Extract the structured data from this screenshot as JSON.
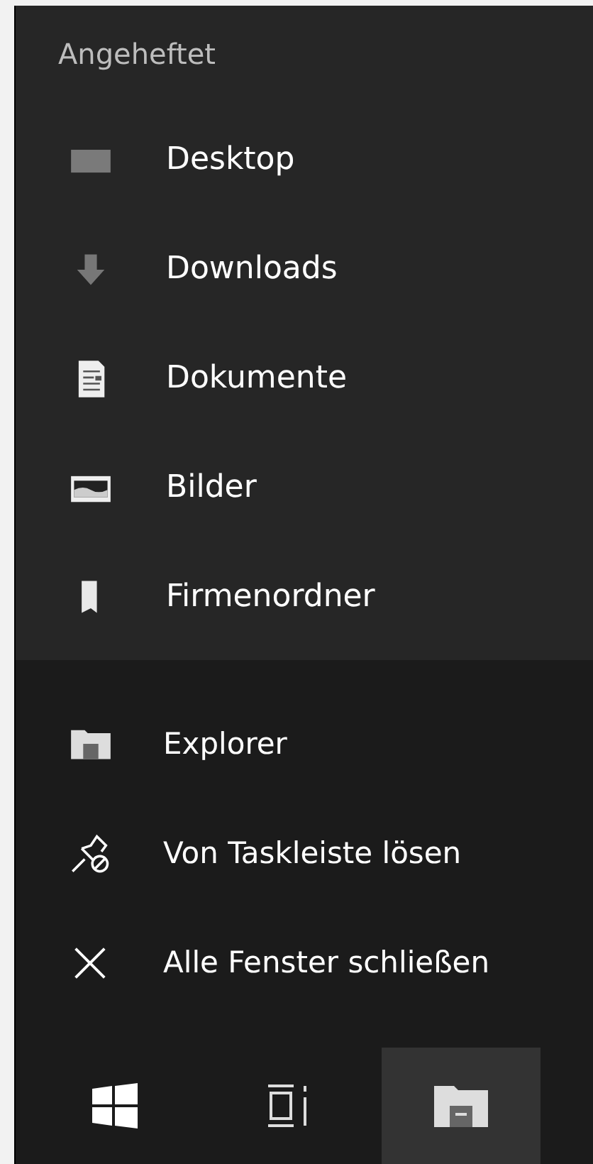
{
  "pinned": {
    "header": "Angeheftet",
    "items": [
      {
        "label": "Desktop",
        "kind": "desktop"
      },
      {
        "label": "Downloads",
        "kind": "download"
      },
      {
        "label": "Dokumente",
        "kind": "document"
      },
      {
        "label": "Bilder",
        "kind": "image"
      },
      {
        "label": "Firmenordner",
        "kind": "folder"
      }
    ]
  },
  "actions": [
    {
      "label": "Explorer",
      "kind": "explorer"
    },
    {
      "label": "Von Taskleiste lösen",
      "kind": "unpin"
    },
    {
      "label": "Alle Fenster schließen",
      "kind": "close"
    }
  ],
  "taskbar": [
    {
      "kind": "start",
      "selected": false
    },
    {
      "kind": "taskview",
      "selected": false
    },
    {
      "kind": "explorer",
      "selected": true
    }
  ]
}
